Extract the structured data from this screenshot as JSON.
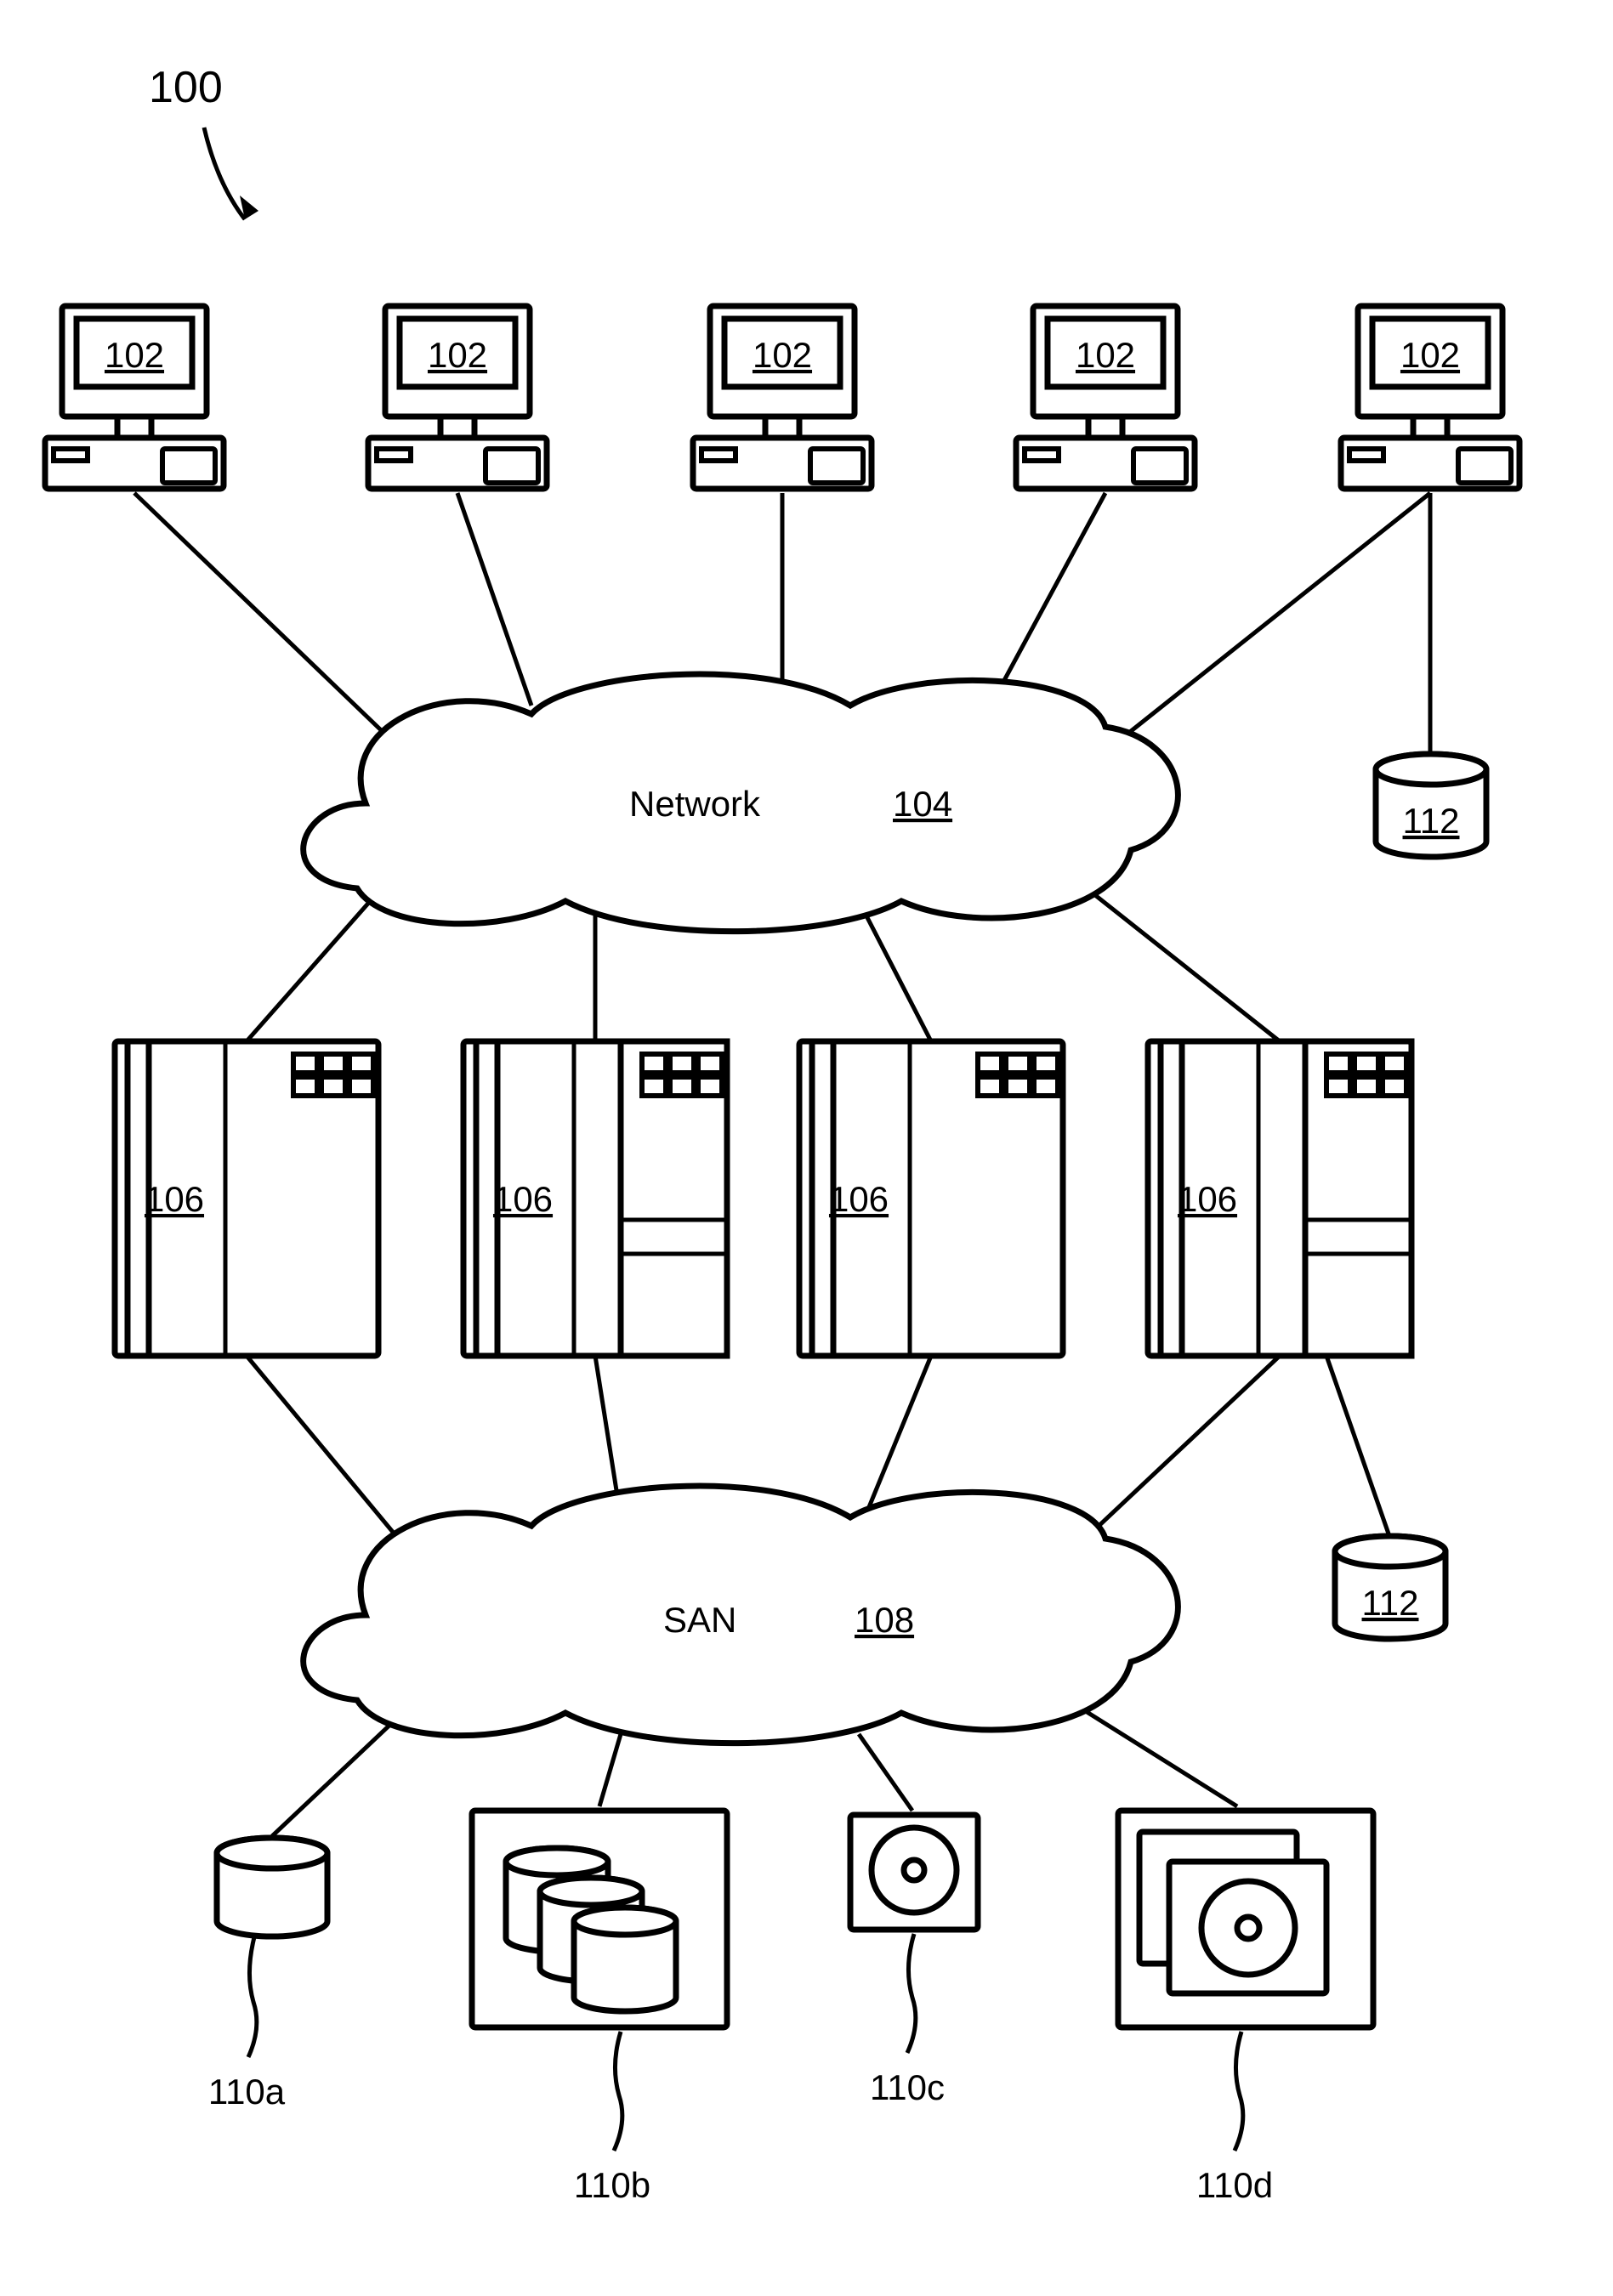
{
  "figure": {
    "title_ref": "100",
    "network_cloud": {
      "label": "Network",
      "ref": "104"
    },
    "san_cloud": {
      "label": "SAN",
      "ref": "108"
    },
    "clients": [
      {
        "ref": "102"
      },
      {
        "ref": "102"
      },
      {
        "ref": "102"
      },
      {
        "ref": "102"
      },
      {
        "ref": "102"
      }
    ],
    "servers": [
      {
        "ref": "106"
      },
      {
        "ref": "106"
      },
      {
        "ref": "106"
      },
      {
        "ref": "106"
      }
    ],
    "das_top": {
      "ref": "112"
    },
    "das_bottom": {
      "ref": "112"
    },
    "storage": [
      {
        "ref": "110a"
      },
      {
        "ref": "110b"
      },
      {
        "ref": "110c"
      },
      {
        "ref": "110d"
      }
    ]
  }
}
